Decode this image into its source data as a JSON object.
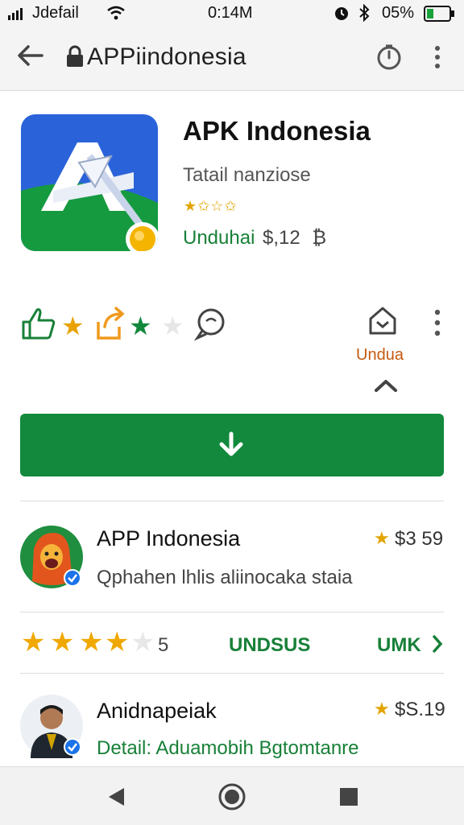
{
  "status": {
    "carrier": "Jdefail",
    "time": "0:14M",
    "battery": "05%"
  },
  "urlbar": {
    "url": "APPiindonesia"
  },
  "app": {
    "title": "APK Indonesia",
    "subtitle": "Tatail nanziose",
    "mini_stars": "★✩☆✩",
    "download_label": "Unduhai",
    "price": "$,12",
    "price_symbol": "₿"
  },
  "actions": {
    "side_label": "Undua",
    "chevron": "^",
    "install_arrow": "↓"
  },
  "list": [
    {
      "title": "APP Indonesia",
      "subtitle": "Qphahen lhlis aliinocaka staia",
      "price": "$3 59"
    },
    {
      "rating_value": "5",
      "label_left": "UNDSUS",
      "label_right": "UMK",
      "chevron": ">"
    },
    {
      "title": "Anidnapeiak",
      "subtitle": "Detail:  Aduamobih Bgtomtanre",
      "price": "$S.19"
    }
  ],
  "colors": {
    "accent_green": "#12893d",
    "star_yellow": "#f0a800",
    "link_orange": "#c65a11"
  }
}
